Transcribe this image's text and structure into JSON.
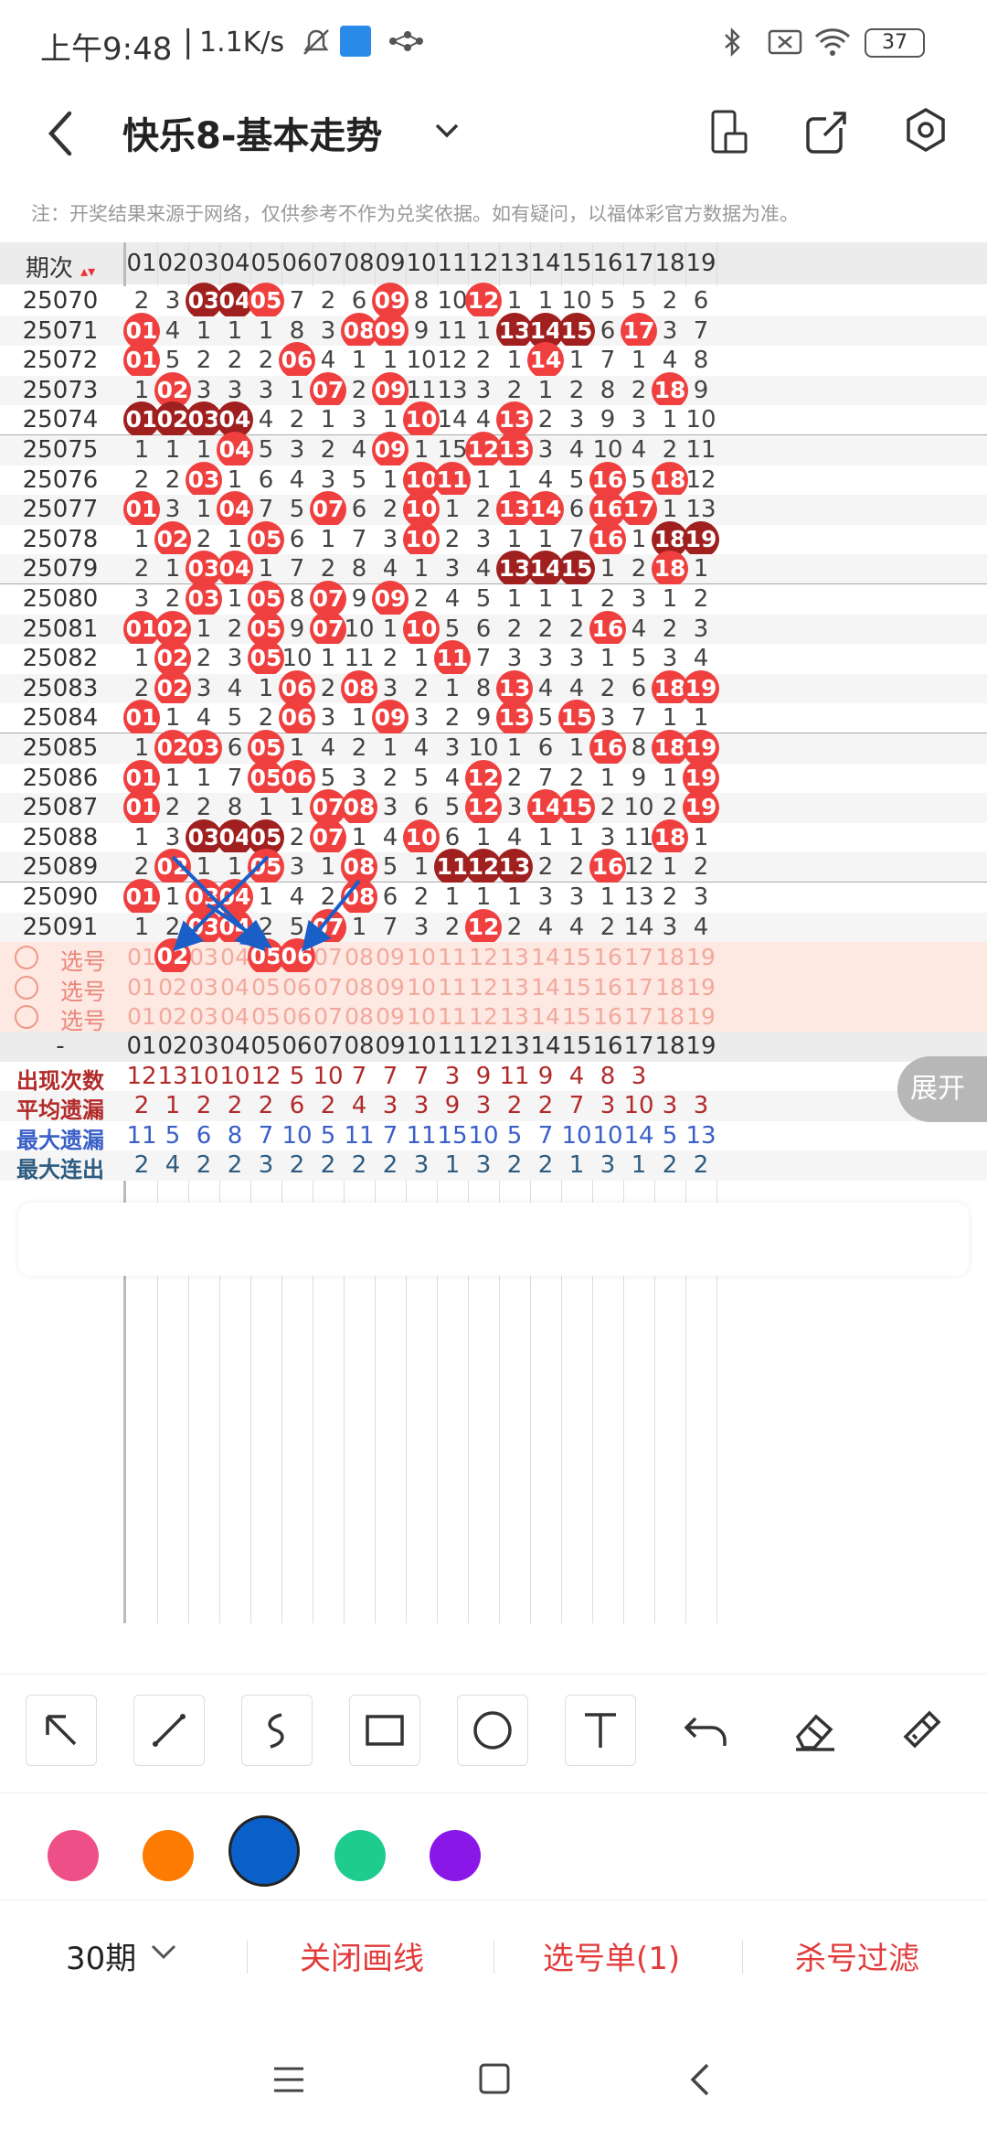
{
  "status": {
    "time": "上午9:48",
    "speed": "1.1K/s",
    "battery": "37"
  },
  "appbar": {
    "title": "快乐8-基本走势"
  },
  "notice": "注：开奖结果来源于网络，仅供参考不作为兑奖依据。如有疑问，以福体彩官方数据为准。",
  "table": {
    "period_header": "期次",
    "numbers": [
      "01",
      "02",
      "03",
      "04",
      "05",
      "06",
      "07",
      "08",
      "09",
      "10",
      "11",
      "12",
      "13",
      "14",
      "15",
      "16",
      "17",
      "18",
      "19"
    ],
    "rows": [
      {
        "p": "25070",
        "v": [
          "2",
          "3",
          "03",
          "04",
          "05",
          "7",
          "2",
          "6",
          "09",
          "8",
          "10",
          "12",
          "1",
          "1",
          "10",
          "5",
          "5",
          "2",
          "6"
        ],
        "b": [
          2,
          3,
          4,
          8,
          11
        ],
        "d": [
          2,
          3
        ]
      },
      {
        "p": "25071",
        "v": [
          "01",
          "4",
          "1",
          "1",
          "1",
          "8",
          "3",
          "08",
          "09",
          "9",
          "11",
          "1",
          "13",
          "14",
          "15",
          "6",
          "17",
          "3",
          "7"
        ],
        "b": [
          0,
          7,
          8,
          12,
          13,
          14,
          16
        ],
        "d": [
          12,
          13,
          14
        ]
      },
      {
        "p": "25072",
        "v": [
          "01",
          "5",
          "2",
          "2",
          "2",
          "06",
          "4",
          "1",
          "1",
          "10",
          "12",
          "2",
          "1",
          "14",
          "1",
          "7",
          "1",
          "4",
          "8"
        ],
        "b": [
          0,
          5,
          13
        ],
        "d": []
      },
      {
        "p": "25073",
        "v": [
          "1",
          "02",
          "3",
          "3",
          "3",
          "1",
          "07",
          "2",
          "09",
          "11",
          "13",
          "3",
          "2",
          "1",
          "2",
          "8",
          "2",
          "18",
          "9"
        ],
        "b": [
          1,
          6,
          8,
          17
        ],
        "d": []
      },
      {
        "p": "25074",
        "v": [
          "01",
          "02",
          "03",
          "04",
          "4",
          "2",
          "1",
          "3",
          "1",
          "10",
          "14",
          "4",
          "13",
          "2",
          "3",
          "9",
          "3",
          "1",
          "10"
        ],
        "b": [
          0,
          1,
          2,
          3,
          9,
          12
        ],
        "d": [
          0,
          1,
          2,
          3
        ]
      },
      {
        "p": "25075",
        "v": [
          "1",
          "1",
          "1",
          "04",
          "5",
          "3",
          "2",
          "4",
          "09",
          "1",
          "15",
          "12",
          "13",
          "3",
          "4",
          "10",
          "4",
          "2",
          "11"
        ],
        "b": [
          3,
          8,
          11,
          12
        ],
        "d": []
      },
      {
        "p": "25076",
        "v": [
          "2",
          "2",
          "03",
          "1",
          "6",
          "4",
          "3",
          "5",
          "1",
          "10",
          "11",
          "1",
          "1",
          "4",
          "5",
          "16",
          "5",
          "18",
          "12"
        ],
        "b": [
          2,
          9,
          10,
          15,
          17
        ],
        "d": []
      },
      {
        "p": "25077",
        "v": [
          "01",
          "3",
          "1",
          "04",
          "7",
          "5",
          "07",
          "6",
          "2",
          "10",
          "1",
          "2",
          "13",
          "14",
          "6",
          "16",
          "17",
          "1",
          "13"
        ],
        "b": [
          0,
          3,
          6,
          9,
          12,
          13,
          15,
          16
        ],
        "d": []
      },
      {
        "p": "25078",
        "v": [
          "1",
          "02",
          "2",
          "1",
          "05",
          "6",
          "1",
          "7",
          "3",
          "10",
          "2",
          "3",
          "1",
          "1",
          "7",
          "16",
          "1",
          "18",
          "19"
        ],
        "b": [
          1,
          4,
          9,
          15,
          17,
          18
        ],
        "d": [
          17,
          18
        ]
      },
      {
        "p": "25079",
        "v": [
          "2",
          "1",
          "03",
          "04",
          "1",
          "7",
          "2",
          "8",
          "4",
          "1",
          "3",
          "4",
          "13",
          "14",
          "15",
          "1",
          "2",
          "18",
          "1"
        ],
        "b": [
          2,
          3,
          12,
          13,
          14,
          17
        ],
        "d": [
          12,
          13,
          14
        ]
      },
      {
        "p": "25080",
        "v": [
          "3",
          "2",
          "03",
          "1",
          "05",
          "8",
          "07",
          "9",
          "09",
          "2",
          "4",
          "5",
          "1",
          "1",
          "1",
          "2",
          "3",
          "1",
          "2"
        ],
        "b": [
          2,
          4,
          6,
          8
        ],
        "d": []
      },
      {
        "p": "25081",
        "v": [
          "01",
          "02",
          "1",
          "2",
          "05",
          "9",
          "07",
          "10",
          "1",
          "10",
          "5",
          "6",
          "2",
          "2",
          "2",
          "16",
          "4",
          "2",
          "3"
        ],
        "b": [
          0,
          1,
          4,
          6,
          9,
          15
        ],
        "d": []
      },
      {
        "p": "25082",
        "v": [
          "1",
          "02",
          "2",
          "3",
          "05",
          "10",
          "1",
          "11",
          "2",
          "1",
          "11",
          "7",
          "3",
          "3",
          "3",
          "1",
          "5",
          "3",
          "4"
        ],
        "b": [
          1,
          4,
          10
        ],
        "d": []
      },
      {
        "p": "25083",
        "v": [
          "2",
          "02",
          "3",
          "4",
          "1",
          "06",
          "2",
          "08",
          "3",
          "2",
          "1",
          "8",
          "13",
          "4",
          "4",
          "2",
          "6",
          "18",
          "19"
        ],
        "b": [
          1,
          5,
          7,
          12,
          17,
          18
        ],
        "d": []
      },
      {
        "p": "25084",
        "v": [
          "01",
          "1",
          "4",
          "5",
          "2",
          "06",
          "3",
          "1",
          "09",
          "3",
          "2",
          "9",
          "13",
          "5",
          "15",
          "3",
          "7",
          "1",
          "1"
        ],
        "b": [
          0,
          5,
          8,
          12,
          14
        ],
        "d": []
      },
      {
        "p": "25085",
        "v": [
          "1",
          "02",
          "03",
          "6",
          "05",
          "1",
          "4",
          "2",
          "1",
          "4",
          "3",
          "10",
          "1",
          "6",
          "1",
          "16",
          "8",
          "18",
          "19"
        ],
        "b": [
          1,
          2,
          4,
          15,
          17,
          18
        ],
        "d": []
      },
      {
        "p": "25086",
        "v": [
          "01",
          "1",
          "1",
          "7",
          "05",
          "06",
          "5",
          "3",
          "2",
          "5",
          "4",
          "12",
          "2",
          "7",
          "2",
          "1",
          "9",
          "1",
          "19"
        ],
        "b": [
          0,
          4,
          5,
          11,
          18
        ],
        "d": []
      },
      {
        "p": "25087",
        "v": [
          "01",
          "2",
          "2",
          "8",
          "1",
          "1",
          "07",
          "08",
          "3",
          "6",
          "5",
          "12",
          "3",
          "14",
          "15",
          "2",
          "10",
          "2",
          "19"
        ],
        "b": [
          0,
          6,
          7,
          11,
          13,
          14,
          18
        ],
        "d": []
      },
      {
        "p": "25088",
        "v": [
          "1",
          "3",
          "03",
          "04",
          "05",
          "2",
          "07",
          "1",
          "4",
          "10",
          "6",
          "1",
          "4",
          "1",
          "1",
          "3",
          "11",
          "18",
          "1"
        ],
        "b": [
          2,
          3,
          4,
          6,
          9,
          17
        ],
        "d": [
          2,
          3,
          4
        ]
      },
      {
        "p": "25089",
        "v": [
          "2",
          "02",
          "1",
          "1",
          "05",
          "3",
          "1",
          "08",
          "5",
          "1",
          "11",
          "12",
          "13",
          "2",
          "2",
          "16",
          "12",
          "1",
          "2"
        ],
        "b": [
          1,
          4,
          7,
          10,
          11,
          12,
          15
        ],
        "d": [
          10,
          11,
          12
        ]
      },
      {
        "p": "25090",
        "v": [
          "01",
          "1",
          "03",
          "04",
          "1",
          "4",
          "2",
          "08",
          "6",
          "2",
          "1",
          "1",
          "1",
          "3",
          "3",
          "1",
          "13",
          "2",
          "3"
        ],
        "b": [
          0,
          2,
          3,
          7
        ],
        "d": []
      },
      {
        "p": "25091",
        "v": [
          "1",
          "2",
          "03",
          "04",
          "2",
          "5",
          "07",
          "1",
          "7",
          "3",
          "2",
          "12",
          "2",
          "4",
          "4",
          "2",
          "14",
          "3",
          "4"
        ],
        "b": [
          2,
          3,
          6,
          11
        ],
        "d": []
      }
    ],
    "select_label": "选号",
    "selected": [
      [
        1,
        4,
        5
      ],
      [],
      []
    ],
    "stats": [
      {
        "label": "出现次数",
        "vals": [
          "12",
          "13",
          "10",
          "10",
          "12",
          "5",
          "10",
          "7",
          "7",
          "7",
          "3",
          "9",
          "11",
          "9",
          "4",
          "8",
          "3",
          "",
          ""
        ],
        "color": "#b22a2a"
      },
      {
        "label": "平均遗漏",
        "vals": [
          "2",
          "1",
          "2",
          "2",
          "2",
          "6",
          "2",
          "4",
          "3",
          "3",
          "9",
          "3",
          "2",
          "2",
          "7",
          "3",
          "10",
          "3",
          "3"
        ],
        "color": "#b22a2a"
      },
      {
        "label": "最大遗漏",
        "vals": [
          "11",
          "5",
          "6",
          "8",
          "7",
          "10",
          "5",
          "11",
          "7",
          "11",
          "15",
          "10",
          "5",
          "7",
          "10",
          "10",
          "14",
          "5",
          "13"
        ],
        "color": "#3a5fc8"
      },
      {
        "label": "最大连出",
        "vals": [
          "2",
          "4",
          "2",
          "2",
          "3",
          "2",
          "2",
          "2",
          "2",
          "3",
          "1",
          "3",
          "2",
          "2",
          "1",
          "3",
          "1",
          "2",
          "2"
        ],
        "color": "#2d5c80"
      }
    ],
    "expand_label": "展开",
    "dash": "-"
  },
  "colors": [
    "#ee4f86",
    "#ff7a00",
    "#0b5fc8",
    "#1ecc8f",
    "#8a17e8"
  ],
  "bottom": {
    "period": "30期",
    "close_draw": "关闭画线",
    "select_list": "选号单(1)",
    "kill_filter": "杀号过滤"
  }
}
